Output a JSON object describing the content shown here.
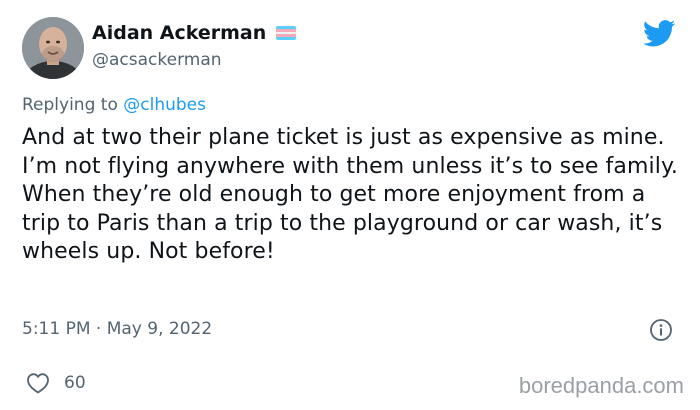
{
  "author": {
    "display_name": "Aidan Ackerman",
    "handle": "@acsackerman",
    "avatar": "profile-photo",
    "badge": "transgender-flag-icon"
  },
  "brand_icon": "twitter-bird-icon",
  "reply": {
    "prefix": "Replying to ",
    "to_handle": "@clhubes"
  },
  "tweet": {
    "text": "And at two their plane ticket is just as expensive as mine. I’m not flying anywhere with them unless it’s to see family. When they’re old enough to get more enjoyment from a trip to Paris than a trip to the playground or car wash, it’s wheels up. Not before!",
    "timestamp": "5:11 PM · May 9, 2022"
  },
  "actions": {
    "like_icon": "heart-icon",
    "like_count": "60",
    "info_icon": "info-icon"
  },
  "watermark": "boredpanda.com",
  "colors": {
    "text": "#0f1419",
    "secondary": "#536471",
    "link": "#1d9bf0",
    "twitter_blue": "#1d9bf0",
    "flag_blue": "#5bcefa",
    "flag_pink": "#f5a9b8",
    "flag_white": "#ffffff",
    "watermark": "#9aa0a6"
  }
}
